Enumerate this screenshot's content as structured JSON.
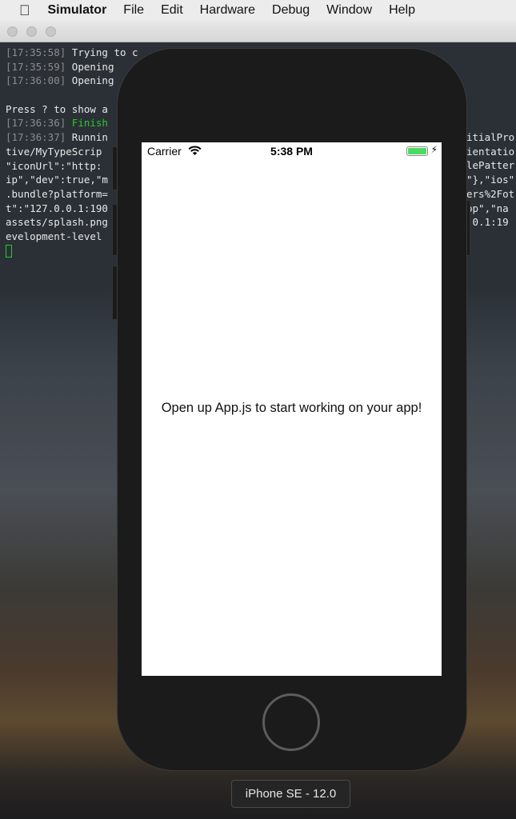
{
  "menubar": {
    "apple_icon": "apple-logo",
    "app": "Simulator",
    "items": [
      "File",
      "Edit",
      "Hardware",
      "Debug",
      "Window",
      "Help"
    ]
  },
  "terminal": {
    "lines": [
      {
        "ts": "[17:35:58]",
        "text": " Trying to c"
      },
      {
        "ts": "[17:35:59]",
        "text": " Opening "
      },
      {
        "ts": "[17:36:00]",
        "text": " Opening"
      },
      {
        "ts": "",
        "text": ""
      },
      {
        "ts": "",
        "text": "Press ? to show a"
      },
      {
        "ts": "[17:36:36]",
        "text": " Finish",
        "green": true
      },
      {
        "ts": "[17:36:37]",
        "text": " Runnin"
      },
      {
        "ts": "",
        "text": "tive/MyTypeScrip"
      },
      {
        "ts": "",
        "text": "\"iconUrl\":\"http:"
      },
      {
        "ts": "",
        "text": "ip\",\"dev\":true,\"m"
      },
      {
        "ts": "",
        "text": ".bundle?platform="
      },
      {
        "ts": "",
        "text": "t\":\"127.0.0.1:190"
      },
      {
        "ts": "",
        "text": "assets/splash.png"
      },
      {
        "ts": "",
        "text": "evelopment-level"
      }
    ],
    "right_lines": [
      "itialPro",
      "ientatio",
      "lePatter",
      "\"},\"ios\"",
      "ers%2Fot",
      "pp\",\"na",
      ".0.1:19"
    ]
  },
  "device": {
    "status": {
      "carrier": "Carrier",
      "time": "5:38 PM",
      "battery_level": 1.0,
      "charging": true,
      "wifi_icon": "wifi-icon"
    },
    "message": "Open up App.js to start working on your app!",
    "label": "iPhone SE - 12.0"
  }
}
